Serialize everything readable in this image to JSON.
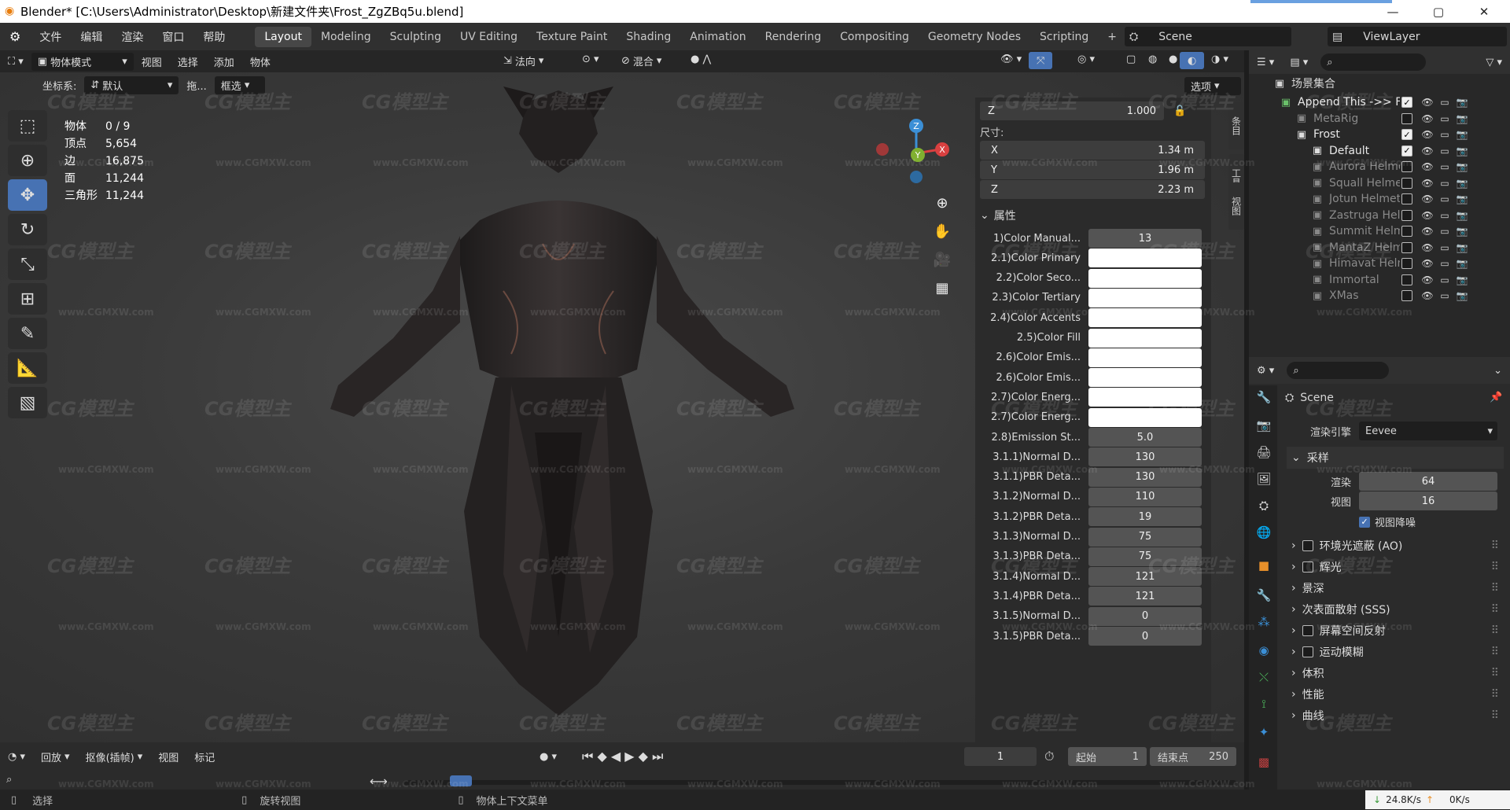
{
  "window": {
    "title": "Blender* [C:\\Users\\Administrator\\Desktop\\新建文件夹\\Frost_ZgZBq5u.blend]",
    "min": "—",
    "max": "▢",
    "close": "✕"
  },
  "menus": [
    "文件",
    "编辑",
    "渲染",
    "窗口",
    "帮助"
  ],
  "workspaces": [
    "Layout",
    "Modeling",
    "Sculpting",
    "UV Editing",
    "Texture Paint",
    "Shading",
    "Animation",
    "Rendering",
    "Compositing",
    "Geometry Nodes",
    "Scripting"
  ],
  "workspace_add": "+",
  "scene_name": "Scene",
  "view_layer": "ViewLayer",
  "header": {
    "mode": "物体模式",
    "items": [
      "视图",
      "选择",
      "添加",
      "物体"
    ],
    "orientation": "法向",
    "blend": "混合",
    "options": "选项"
  },
  "header2": {
    "coord_label": "坐标系:",
    "coord_value": "默认",
    "drag_label": "拖...",
    "select": "框选"
  },
  "stats": [
    {
      "k": "物体",
      "v": "0 / 9"
    },
    {
      "k": "顶点",
      "v": "5,654"
    },
    {
      "k": "边",
      "v": "16,875"
    },
    {
      "k": "面",
      "v": "11,244"
    },
    {
      "k": "三角形",
      "v": "11,244"
    }
  ],
  "gizmo": {
    "x": "X",
    "y": "Y",
    "z": "Z"
  },
  "npanel": {
    "z_top": {
      "label": "Z",
      "value": "1.000"
    },
    "dims_label": "尺寸:",
    "dims": [
      {
        "axis": "X",
        "value": "1.34 m"
      },
      {
        "axis": "Y",
        "value": "1.96 m"
      },
      {
        "axis": "Z",
        "value": "2.23 m"
      }
    ],
    "attr_header": "属性",
    "props": [
      {
        "label": "1)Color Manual...",
        "value": "13"
      },
      {
        "label": "2.1)Color Primary",
        "color": true
      },
      {
        "label": "2.2)Color Seco...",
        "color": true
      },
      {
        "label": "2.3)Color Tertiary",
        "color": true
      },
      {
        "label": "2.4)Color Accents",
        "color": true
      },
      {
        "label": "2.5)Color Fill",
        "color": true
      },
      {
        "label": "2.6)Color Emis...",
        "color": true
      },
      {
        "label": "2.6)Color Emis...",
        "color": true
      },
      {
        "label": "2.7)Color Energ...",
        "color": true
      },
      {
        "label": "2.7)Color Energ...",
        "color": true
      },
      {
        "label": "2.8)Emission St...",
        "value": "5.0"
      },
      {
        "label": "3.1.1)Normal D...",
        "value": "130"
      },
      {
        "label": "3.1.1)PBR Deta...",
        "value": "130"
      },
      {
        "label": "3.1.2)Normal D...",
        "value": "110"
      },
      {
        "label": "3.1.2)PBR Deta...",
        "value": "19"
      },
      {
        "label": "3.1.3)Normal D...",
        "value": "75"
      },
      {
        "label": "3.1.3)PBR Deta...",
        "value": "75"
      },
      {
        "label": "3.1.4)Normal D...",
        "value": "121"
      },
      {
        "label": "3.1.4)PBR Deta...",
        "value": "121"
      },
      {
        "label": "3.1.5)Normal D...",
        "value": "0"
      },
      {
        "label": "3.1.5)PBR Deta...",
        "value": "0"
      }
    ],
    "tabs": [
      "条目",
      "工具",
      "视图"
    ]
  },
  "outliner": {
    "root": "场景集合",
    "items": [
      {
        "name": "Append This ->> Fro",
        "indent": 1,
        "checked": true,
        "kind": "collection"
      },
      {
        "name": "MetaRig",
        "indent": 2,
        "checked": false,
        "kind": "collection"
      },
      {
        "name": "Frost",
        "indent": 2,
        "checked": true,
        "kind": "collection"
      },
      {
        "name": "Default",
        "indent": 3,
        "checked": true,
        "kind": "collection"
      },
      {
        "name": "Aurora Helme",
        "indent": 3,
        "checked": false,
        "kind": "collection"
      },
      {
        "name": "Squall Helmet",
        "indent": 3,
        "checked": false,
        "kind": "collection"
      },
      {
        "name": "Jotun Helmet",
        "indent": 3,
        "checked": false,
        "kind": "collection"
      },
      {
        "name": "Zastruga Heln",
        "indent": 3,
        "checked": false,
        "kind": "collection"
      },
      {
        "name": "Summit Helm",
        "indent": 3,
        "checked": false,
        "kind": "collection"
      },
      {
        "name": "MantaZ Helm",
        "indent": 3,
        "checked": false,
        "kind": "collection"
      },
      {
        "name": "Himavat Helm",
        "indent": 3,
        "checked": false,
        "kind": "collection"
      },
      {
        "name": "Immortal",
        "indent": 3,
        "checked": false,
        "kind": "collection"
      },
      {
        "name": "XMas",
        "indent": 3,
        "checked": false,
        "kind": "collection"
      }
    ]
  },
  "properties": {
    "scene": "Scene",
    "engine_label": "渲染引擎",
    "engine_value": "Eevee",
    "sampling": "采样",
    "render_label": "渲染",
    "render_value": "64",
    "viewport_label": "视图",
    "viewport_value": "16",
    "denoise": "视图降噪",
    "sections": [
      {
        "label": "环境光遮蔽 (AO)",
        "check": true
      },
      {
        "label": "辉光",
        "check": true
      },
      {
        "label": "景深",
        "check": false
      },
      {
        "label": "次表面散射 (SSS)",
        "check": false
      },
      {
        "label": "屏幕空间反射",
        "check": true
      },
      {
        "label": "运动模糊",
        "check": true
      },
      {
        "label": "体积",
        "check": false
      },
      {
        "label": "性能",
        "check": false
      },
      {
        "label": "曲线",
        "check": false
      }
    ]
  },
  "timeline": {
    "menu": [
      "回放",
      "抠像(插帧)",
      "视图",
      "标记"
    ],
    "current": "1",
    "start_label": "起始",
    "start": "1",
    "end_label": "结束点",
    "end": "250"
  },
  "status": {
    "select": "选择",
    "rotate": "旋转视图",
    "context": "物体上下文菜单",
    "down": "24.8K/s",
    "up": "0K/s"
  },
  "watermark": "CG模型主",
  "watermark_url": "www.CGMXW.com"
}
